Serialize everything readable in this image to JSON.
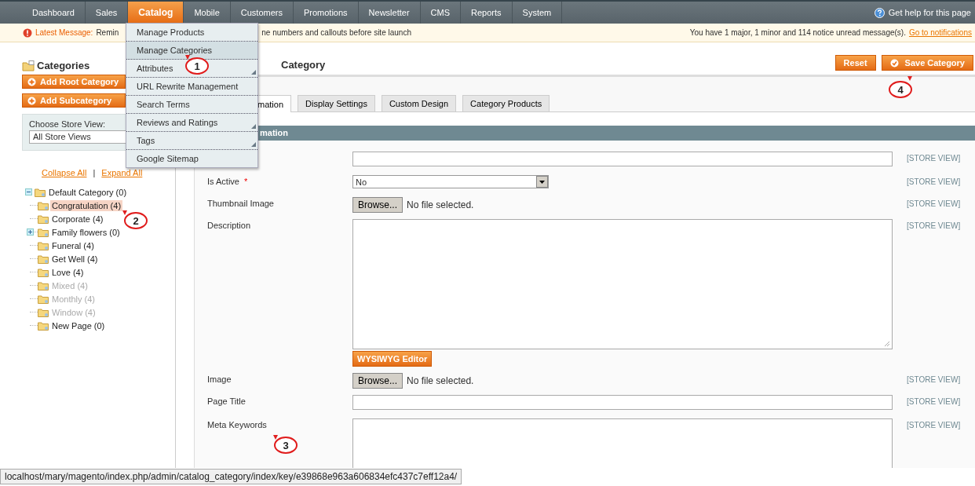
{
  "nav": {
    "items": [
      {
        "label": "Dashboard",
        "selected": false
      },
      {
        "label": "Sales",
        "selected": false
      },
      {
        "label": "Catalog",
        "selected": true
      },
      {
        "label": "Mobile",
        "selected": false
      },
      {
        "label": "Customers",
        "selected": false
      },
      {
        "label": "Promotions",
        "selected": false
      },
      {
        "label": "Newsletter",
        "selected": false
      },
      {
        "label": "CMS",
        "selected": false
      },
      {
        "label": "Reports",
        "selected": false
      },
      {
        "label": "System",
        "selected": false
      }
    ],
    "help": "Get help for this page"
  },
  "message_bar": {
    "title": "Latest Message:",
    "text_start": "Remin",
    "text_end": "ne numbers and callouts before site launch",
    "summary": "You have 1 major, 1 minor and 114 notice unread message(s).",
    "link": "Go to notifications"
  },
  "catalog_menu": [
    {
      "label": "Manage Products",
      "selected": false,
      "submenu": false
    },
    {
      "label": "Manage Categories",
      "selected": true,
      "submenu": false
    },
    {
      "label": "Attributes",
      "selected": false,
      "submenu": true
    },
    {
      "label": "URL Rewrite Management",
      "selected": false,
      "submenu": false
    },
    {
      "label": "Search Terms",
      "selected": false,
      "submenu": false
    },
    {
      "label": "Reviews and Ratings",
      "selected": false,
      "submenu": true
    },
    {
      "label": "Tags",
      "selected": false,
      "submenu": true
    },
    {
      "label": "Google Sitemap",
      "selected": false,
      "submenu": false
    }
  ],
  "sidebar": {
    "title": "Categories",
    "buttons": [
      "Add Root Category",
      "Add Subcategory"
    ],
    "store_view_label": "Choose Store View:",
    "store_view_value": "All Store Views",
    "collapse_all": "Collapse All",
    "separator": "|",
    "expand_all": "Expand All",
    "tree": [
      {
        "label": "Default Category (0)",
        "selected": false,
        "disabled": false,
        "expanded": true,
        "children": [
          {
            "label": "Congratulation (4)",
            "selected": true,
            "disabled": false
          },
          {
            "label": "Corporate (4)",
            "selected": false,
            "disabled": false
          },
          {
            "label": "Family flowers (0)",
            "selected": false,
            "disabled": false,
            "expanded": false
          },
          {
            "label": "Funeral (4)",
            "selected": false,
            "disabled": false
          },
          {
            "label": "Get Well (4)",
            "selected": false,
            "disabled": false
          },
          {
            "label": "Love (4)",
            "selected": false,
            "disabled": false
          },
          {
            "label": "Mixed (4)",
            "selected": false,
            "disabled": true
          },
          {
            "label": "Monthly (4)",
            "selected": false,
            "disabled": true
          },
          {
            "label": "Window (4)",
            "selected": false,
            "disabled": true
          },
          {
            "label": "New Page (0)",
            "selected": false,
            "disabled": false
          }
        ]
      }
    ]
  },
  "main": {
    "title": "Category",
    "buttons": [
      {
        "label": "Reset",
        "kind": "plain"
      },
      {
        "label": "Save Category",
        "kind": "save"
      }
    ],
    "tabs": [
      {
        "label": "mation",
        "selected": true
      },
      {
        "label": "Display Settings",
        "selected": false
      },
      {
        "label": "Custom Design",
        "selected": false
      },
      {
        "label": "Category Products",
        "selected": false
      }
    ],
    "section_title": "mation",
    "fields": [
      {
        "kind": "text",
        "scope": "[STORE VIEW]"
      },
      {
        "kind": "select",
        "label": "Is Active",
        "required_mark": "*",
        "value": "No",
        "scope": "[STORE VIEW]"
      },
      {
        "kind": "file",
        "label": "Thumbnail Image",
        "button": "Browse...",
        "status": "No file selected.",
        "scope": "[STORE VIEW]"
      },
      {
        "kind": "textarea",
        "label": "Description",
        "button": "WYSIWYG Editor",
        "scope": "[STORE VIEW]"
      },
      {
        "kind": "file",
        "label": "Image",
        "button": "Browse...",
        "status": "No file selected.",
        "scope": "[STORE VIEW]"
      },
      {
        "kind": "text",
        "label": "Page Title",
        "scope": "[STORE VIEW]"
      },
      {
        "kind": "tall",
        "label": "Meta Keywords",
        "scope": "[STORE VIEW]"
      }
    ]
  },
  "callouts": [
    {
      "label": "1"
    },
    {
      "label": "2"
    },
    {
      "label": "3"
    },
    {
      "label": "4"
    }
  ],
  "status_bar": "localhost/mary/magento/index.php/admin/catalog_category/index/key/e39868e963a606834efc437c7eff12a4/"
}
